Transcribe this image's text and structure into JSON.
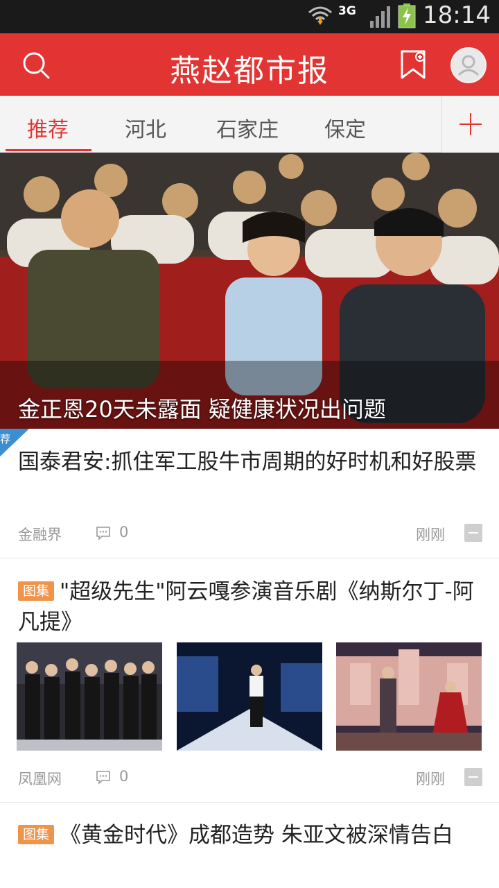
{
  "status_bar": {
    "network": "3G",
    "time": "18:14"
  },
  "header": {
    "title": "燕赵都市报"
  },
  "tabs": [
    {
      "label": "推荐",
      "active": true
    },
    {
      "label": "河北",
      "active": false
    },
    {
      "label": "石家庄",
      "active": false
    },
    {
      "label": "保定",
      "active": false
    }
  ],
  "hero": {
    "caption": "金正恩20天未露面 疑健康状况出问题"
  },
  "badge": {
    "label": "荐"
  },
  "articles": [
    {
      "title": "国泰君安:抓住军工股牛市周期的好时机和好股票",
      "source": "金融界",
      "comments": "0",
      "time": "刚刚"
    },
    {
      "tag": "图集",
      "title": "\"超级先生\"阿云嘎参演音乐剧《纳斯尔丁-阿凡提》",
      "source": "凤凰网",
      "comments": "0",
      "time": "刚刚"
    },
    {
      "tag": "图集",
      "title": "《黄金时代》成都造势 朱亚文被深情告白"
    }
  ],
  "colors": {
    "accent": "#e23432",
    "tag": "#f0944a",
    "badge": "#3b8fd0"
  },
  "icons": [
    "search-icon",
    "bookmark-icon",
    "avatar-icon",
    "plus-icon",
    "comment-icon",
    "dismiss-icon",
    "wifi-icon",
    "signal-icon",
    "battery-icon"
  ]
}
